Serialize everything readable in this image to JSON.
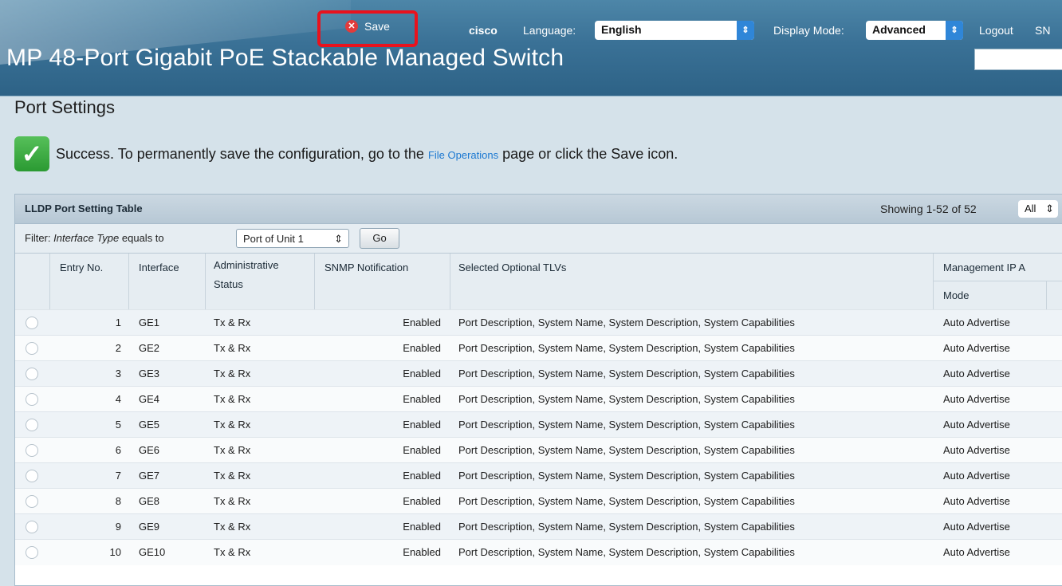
{
  "header": {
    "save_label": "Save",
    "brand": "cisco",
    "language_label": "Language:",
    "language_value": "English",
    "display_mode_label": "Display Mode:",
    "display_mode_value": "Advanced",
    "logout_label": "Logout",
    "truncated_label": "SN",
    "product_title": "MP 48-Port Gigabit PoE Stackable Managed Switch"
  },
  "page": {
    "title": "Port Settings",
    "success_prefix": "Success. To permanently save the configuration, go to the",
    "success_link": "File Operations",
    "success_suffix": "page or click the Save icon."
  },
  "table": {
    "title": "LLDP Port Setting Table",
    "showing": "Showing 1-52 of 52",
    "page_select": "All",
    "filter_label": "Filter:",
    "filter_field": "Interface Type",
    "filter_op": "equals to",
    "filter_value": "Port of Unit 1",
    "go_label": "Go",
    "columns": {
      "entry": "Entry No.",
      "interface": "Interface",
      "admin_line1": "Administrative",
      "admin_line2": "Status",
      "snmp": "SNMP Notification",
      "tlvs": "Selected Optional TLVs",
      "mgmt": "Management IP A",
      "mode": "Mode"
    },
    "rows": [
      {
        "entry": "1",
        "interface": "GE1",
        "admin": "Tx & Rx",
        "snmp": "Enabled",
        "tlvs": "Port Description, System Name, System Description, System Capabilities",
        "mode": "Auto Advertise"
      },
      {
        "entry": "2",
        "interface": "GE2",
        "admin": "Tx & Rx",
        "snmp": "Enabled",
        "tlvs": "Port Description, System Name, System Description, System Capabilities",
        "mode": "Auto Advertise"
      },
      {
        "entry": "3",
        "interface": "GE3",
        "admin": "Tx & Rx",
        "snmp": "Enabled",
        "tlvs": "Port Description, System Name, System Description, System Capabilities",
        "mode": "Auto Advertise"
      },
      {
        "entry": "4",
        "interface": "GE4",
        "admin": "Tx & Rx",
        "snmp": "Enabled",
        "tlvs": "Port Description, System Name, System Description, System Capabilities",
        "mode": "Auto Advertise"
      },
      {
        "entry": "5",
        "interface": "GE5",
        "admin": "Tx & Rx",
        "snmp": "Enabled",
        "tlvs": "Port Description, System Name, System Description, System Capabilities",
        "mode": "Auto Advertise"
      },
      {
        "entry": "6",
        "interface": "GE6",
        "admin": "Tx & Rx",
        "snmp": "Enabled",
        "tlvs": "Port Description, System Name, System Description, System Capabilities",
        "mode": "Auto Advertise"
      },
      {
        "entry": "7",
        "interface": "GE7",
        "admin": "Tx & Rx",
        "snmp": "Enabled",
        "tlvs": "Port Description, System Name, System Description, System Capabilities",
        "mode": "Auto Advertise"
      },
      {
        "entry": "8",
        "interface": "GE8",
        "admin": "Tx & Rx",
        "snmp": "Enabled",
        "tlvs": "Port Description, System Name, System Description, System Capabilities",
        "mode": "Auto Advertise"
      },
      {
        "entry": "9",
        "interface": "GE9",
        "admin": "Tx & Rx",
        "snmp": "Enabled",
        "tlvs": "Port Description, System Name, System Description, System Capabilities",
        "mode": "Auto Advertise"
      },
      {
        "entry": "10",
        "interface": "GE10",
        "admin": "Tx & Rx",
        "snmp": "Enabled",
        "tlvs": "Port Description, System Name, System Description, System Capabilities",
        "mode": "Auto Advertise"
      }
    ]
  },
  "colors": {
    "header_bg": "#3a7196",
    "save_highlight": "#e8121d",
    "link": "#1b78d1",
    "success_green": "#2b9a32",
    "select_arrow": "#2f86d8"
  },
  "icons": {
    "save": "error-circle-icon",
    "success": "check-icon",
    "dropdown": "chevron-updown-icon"
  }
}
